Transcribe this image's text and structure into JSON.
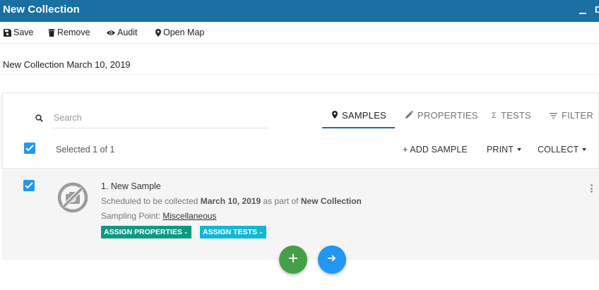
{
  "window": {
    "title": "New Collection",
    "minimize_icon": "minimize-icon",
    "extra_label": "D"
  },
  "toolbar": {
    "save": {
      "label": "Save",
      "icon": "save-icon"
    },
    "remove": {
      "label": "Remove",
      "icon": "trash-icon"
    },
    "audit": {
      "label": "Audit",
      "icon": "eye-icon"
    },
    "open_map": {
      "label": "Open Map",
      "icon": "map-pin-icon"
    }
  },
  "collection": {
    "name": "New Collection March 10, 2019"
  },
  "search": {
    "placeholder": "Search",
    "value": ""
  },
  "tabs": [
    {
      "label": "SAMPLES",
      "icon": "map-pin-icon",
      "active": true
    },
    {
      "label": "PROPERTIES",
      "icon": "pencil-icon",
      "active": false
    },
    {
      "label": "TESTS",
      "icon": "sigma-icon",
      "active": false
    },
    {
      "label": "FILTER",
      "icon": "filter-icon",
      "active": false
    }
  ],
  "selection": {
    "text": "Selected 1 of 1",
    "all_checked": true
  },
  "actions": {
    "add_sample": "+ ADD SAMPLE",
    "print": "PRINT",
    "collect": "COLLECT"
  },
  "sample": {
    "title": "1. New Sample",
    "schedule_prefix": "Scheduled to be collected ",
    "schedule_date": "March 10, 2019",
    "schedule_mid": " as part of ",
    "schedule_collection": "New Collection",
    "sampling_label": "Sampling Point: ",
    "sampling_point": "Miscellaneous",
    "checked": true,
    "image_icon": "no-image-icon",
    "assign_properties": "ASSIGN PROPERTIES",
    "assign_tests": "ASSIGN TESTS"
  },
  "fabs": {
    "add_icon": "plus-icon",
    "next_icon": "arrow-right-icon"
  },
  "colors": {
    "header": "#1a6fa3",
    "checkbox": "#2196f3",
    "assign_properties": "#0e9985",
    "assign_tests": "#11b8d4",
    "fab_add": "#43a047",
    "fab_next": "#2196f3"
  }
}
